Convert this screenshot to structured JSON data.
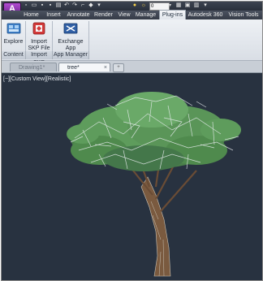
{
  "app": {
    "logo_letter": "A",
    "logo_sub": "MEP"
  },
  "quick_access": {
    "workspace_value": "0"
  },
  "ribbon_tabs": [
    {
      "label": "Home"
    },
    {
      "label": "Insert"
    },
    {
      "label": "Annotate"
    },
    {
      "label": "Render"
    },
    {
      "label": "View"
    },
    {
      "label": "Manage"
    },
    {
      "label": "Plug-ins"
    },
    {
      "label": "Autodesk 360"
    },
    {
      "label": "Vision Tools"
    }
  ],
  "active_tab": "Plug-ins",
  "ribbon": {
    "buttons": [
      {
        "label_line1": "Explore",
        "label_line2": ""
      },
      {
        "label_line1": "Import",
        "label_line2": "SKP File"
      },
      {
        "label_line1": "Exchange",
        "label_line2": "App Manager"
      }
    ],
    "panels": [
      {
        "label": "Content"
      },
      {
        "label": "Import SKP"
      },
      {
        "label": "App Manager"
      }
    ]
  },
  "document_tabs": [
    {
      "label": "Drawing1*",
      "active": false
    },
    {
      "label": "tree*",
      "active": true
    }
  ],
  "viewport": {
    "label": "[−][Custom View][Realistic]",
    "background": "#283240"
  },
  "colors": {
    "ribbon_bg": "#e3e7ec",
    "accent": "#7a2a9a",
    "foliage": "#5f9a5c",
    "trunk": "#7a5a3f"
  }
}
